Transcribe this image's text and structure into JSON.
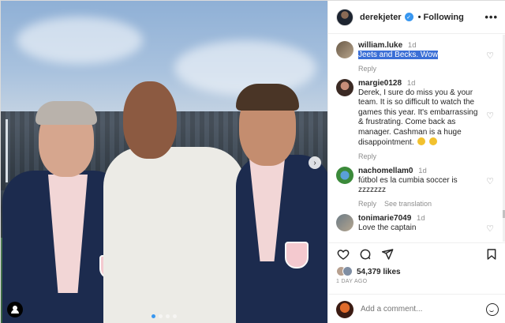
{
  "post": {
    "author": "derekjeter",
    "follow_state": "Following",
    "more_glyph": "•••",
    "likes": "54,379 likes",
    "date": "1 DAY AGO"
  },
  "comments": [
    {
      "user": "william.luke",
      "time": "1d",
      "text": "Jeets and Becks. Wow",
      "reply": "Reply"
    },
    {
      "user": "margie0128",
      "time": "1d",
      "text": "Derek, I sure do miss you & your team. It is so difficult to watch the games this year. It's embarrassing & frustrating. Come back as manager. Cashman is a huge disappointment.",
      "reply": "Reply"
    },
    {
      "user": "nachomellam0",
      "time": "1d",
      "text": "fútbol es la cumbia soccer is zzzzzzz",
      "reply": "Reply",
      "translate": "See translation"
    },
    {
      "user": "tonimarie7049",
      "time": "1d",
      "text": "Love the captain",
      "reply": "Reply"
    }
  ],
  "composer": {
    "placeholder": "Add a comment..."
  },
  "icons": {
    "like": "heart-icon",
    "comment": "comment-bubble-icon",
    "share": "paper-plane-icon",
    "save": "bookmark-icon",
    "emoji": "smiley-icon",
    "verified": "verified-badge-icon"
  }
}
